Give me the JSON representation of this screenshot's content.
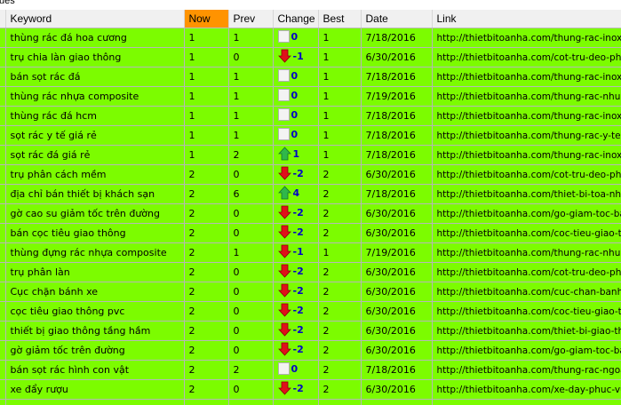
{
  "window": {
    "title_fragment": "ues"
  },
  "table": {
    "columns": [
      "Keyword",
      "Now",
      "Prev",
      "Change",
      "Best",
      "Date",
      "Link"
    ],
    "sorted_column": "Now",
    "colors": {
      "row_bg": "#7cfc00",
      "header_bg": "#f0f0f0",
      "sorted_header_bg": "#ff9300",
      "down_arrow": "#e0101a",
      "up_arrow": "#2fb84a",
      "change_text": "#0000c8"
    },
    "rows": [
      {
        "keyword": "thùng rác đá hoa cương",
        "now": "1",
        "prev": "1",
        "change_icon": "zero-icon",
        "change": "0",
        "best": "1",
        "date": "7/18/2016",
        "link": "http://thietbitoanha.com/thung-rac-inox-..."
      },
      {
        "keyword": "trụ chia làn giao thông",
        "now": "1",
        "prev": "0",
        "change_icon": "arrow-down-icon",
        "change": "-1",
        "best": "1",
        "date": "6/30/2016",
        "link": "http://thietbitoanha.com/cot-tru-deo-pha..."
      },
      {
        "keyword": "bán sọt rác đá",
        "now": "1",
        "prev": "1",
        "change_icon": "zero-icon",
        "change": "0",
        "best": "1",
        "date": "7/18/2016",
        "link": "http://thietbitoanha.com/thung-rac-inox-..."
      },
      {
        "keyword": "thùng rác nhựa composite",
        "now": "1",
        "prev": "1",
        "change_icon": "zero-icon",
        "change": "0",
        "best": "1",
        "date": "7/19/2016",
        "link": "http://thietbitoanha.com/thung-rac-nhua-..."
      },
      {
        "keyword": "thùng rác đá hcm",
        "now": "1",
        "prev": "1",
        "change_icon": "zero-icon",
        "change": "0",
        "best": "1",
        "date": "7/18/2016",
        "link": "http://thietbitoanha.com/thung-rac-inox-..."
      },
      {
        "keyword": "sọt rác y tế giá rẻ",
        "now": "1",
        "prev": "1",
        "change_icon": "zero-icon",
        "change": "0",
        "best": "1",
        "date": "7/18/2016",
        "link": "http://thietbitoanha.com/thung-rac-y-te.h..."
      },
      {
        "keyword": "sọt rác đá giá rẻ",
        "now": "1",
        "prev": "2",
        "change_icon": "arrow-up-icon",
        "change": "1",
        "best": "1",
        "date": "7/18/2016",
        "link": "http://thietbitoanha.com/thung-rac-inox-..."
      },
      {
        "keyword": "trụ phân cách mềm",
        "now": "2",
        "prev": "0",
        "change_icon": "arrow-down-icon",
        "change": "-2",
        "best": "2",
        "date": "6/30/2016",
        "link": "http://thietbitoanha.com/cot-tru-deo-pha..."
      },
      {
        "keyword": "địa chỉ bán thiết bị khách sạn",
        "now": "2",
        "prev": "6",
        "change_icon": "arrow-up-icon",
        "change": "4",
        "best": "2",
        "date": "7/18/2016",
        "link": "http://thietbitoanha.com/thiet-bi-toa-nha-..."
      },
      {
        "keyword": "gờ cao su giảm tốc trên đường",
        "now": "2",
        "prev": "0",
        "change_icon": "arrow-down-icon",
        "change": "-2",
        "best": "2",
        "date": "6/30/2016",
        "link": "http://thietbitoanha.com/go-giam-toc-ba..."
      },
      {
        "keyword": "bán cọc tiêu giao thông",
        "now": "2",
        "prev": "0",
        "change_icon": "arrow-down-icon",
        "change": "-2",
        "best": "2",
        "date": "6/30/2016",
        "link": "http://thietbitoanha.com/coc-tieu-giao-th..."
      },
      {
        "keyword": "thùng đựng rác nhựa composite",
        "now": "2",
        "prev": "1",
        "change_icon": "arrow-down-icon",
        "change": "-1",
        "best": "1",
        "date": "7/19/2016",
        "link": "http://thietbitoanha.com/thung-rac-nhua-..."
      },
      {
        "keyword": "trụ phân làn",
        "now": "2",
        "prev": "0",
        "change_icon": "arrow-down-icon",
        "change": "-2",
        "best": "2",
        "date": "6/30/2016",
        "link": "http://thietbitoanha.com/cot-tru-deo-pha..."
      },
      {
        "keyword": "Cục chặn bánh xe",
        "now": "2",
        "prev": "0",
        "change_icon": "arrow-down-icon",
        "change": "-2",
        "best": "2",
        "date": "6/30/2016",
        "link": "http://thietbitoanha.com/cuc-chan-banh-..."
      },
      {
        "keyword": "cọc tiêu giao thông pvc",
        "now": "2",
        "prev": "0",
        "change_icon": "arrow-down-icon",
        "change": "-2",
        "best": "2",
        "date": "6/30/2016",
        "link": "http://thietbitoanha.com/coc-tieu-giao-th..."
      },
      {
        "keyword": "thiết bị giao thông tầng hầm",
        "now": "2",
        "prev": "0",
        "change_icon": "arrow-down-icon",
        "change": "-2",
        "best": "2",
        "date": "6/30/2016",
        "link": "http://thietbitoanha.com/thiet-bi-giao-tho..."
      },
      {
        "keyword": "gờ giảm tốc trên đường",
        "now": "2",
        "prev": "0",
        "change_icon": "arrow-down-icon",
        "change": "-2",
        "best": "2",
        "date": "6/30/2016",
        "link": "http://thietbitoanha.com/go-giam-toc-ba..."
      },
      {
        "keyword": "bán sọt rác hình con vật",
        "now": "2",
        "prev": "2",
        "change_icon": "zero-icon",
        "change": "0",
        "best": "2",
        "date": "7/18/2016",
        "link": "http://thietbitoanha.com/thung-rac-ngoai..."
      },
      {
        "keyword": "xe đẩy rượu",
        "now": "2",
        "prev": "0",
        "change_icon": "arrow-down-icon",
        "change": "-2",
        "best": "2",
        "date": "6/30/2016",
        "link": "http://thietbitoanha.com/xe-day-phuc-vu..."
      }
    ]
  }
}
